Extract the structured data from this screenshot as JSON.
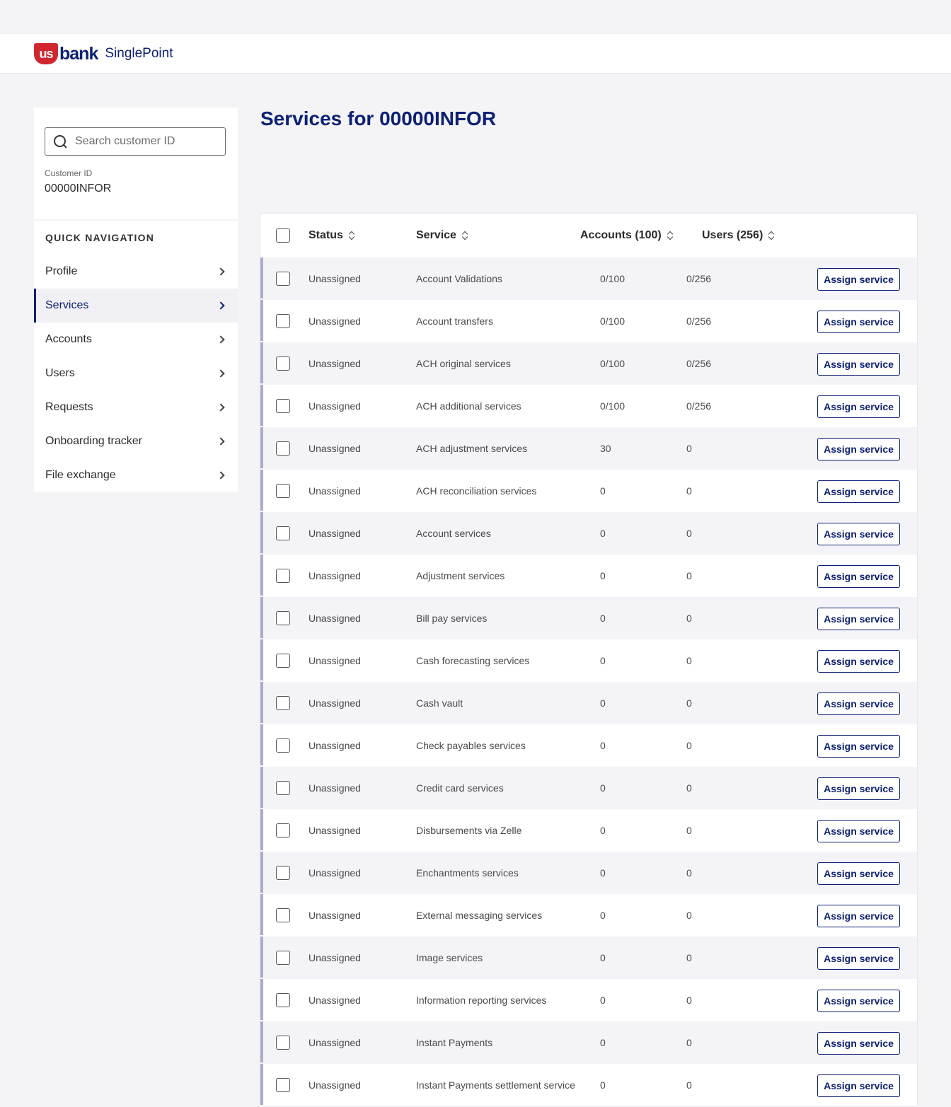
{
  "brand": {
    "shield_text": "us",
    "bank_text": "bank",
    "product_name": "SinglePoint",
    "colors": {
      "primary": "#0c2074",
      "accent": "#d12630"
    }
  },
  "sidebar": {
    "search": {
      "placeholder": "Search customer ID",
      "value": ""
    },
    "customer_label": "Customer ID",
    "customer_value": "00000INFOR",
    "nav_heading": "QUICK NAVIGATION",
    "items": [
      {
        "label": "Profile",
        "active": false
      },
      {
        "label": "Services",
        "active": true
      },
      {
        "label": "Accounts",
        "active": false
      },
      {
        "label": "Users",
        "active": false
      },
      {
        "label": "Requests",
        "active": false
      },
      {
        "label": "Onboarding tracker",
        "active": false
      },
      {
        "label": "File exchange",
        "active": false
      }
    ]
  },
  "main": {
    "title": "Services for 00000INFOR",
    "table": {
      "headers": {
        "status": "Status",
        "service": "Service",
        "accounts": "Accounts (100)",
        "users": "Users (256)"
      },
      "action_label": "Assign service",
      "rows": [
        {
          "status": "Unassigned",
          "service": "Account Validations",
          "accounts": "0/100",
          "users": "0/256"
        },
        {
          "status": "Unassigned",
          "service": "Account transfers",
          "accounts": "0/100",
          "users": "0/256"
        },
        {
          "status": "Unassigned",
          "service": "ACH original services",
          "accounts": "0/100",
          "users": "0/256"
        },
        {
          "status": "Unassigned",
          "service": "ACH additional services",
          "accounts": "0/100",
          "users": "0/256"
        },
        {
          "status": "Unassigned",
          "service": "ACH adjustment services",
          "accounts": "30",
          "users": "0"
        },
        {
          "status": "Unassigned",
          "service": "ACH reconciliation services",
          "accounts": "0",
          "users": "0"
        },
        {
          "status": "Unassigned",
          "service": "Account services",
          "accounts": "0",
          "users": "0"
        },
        {
          "status": "Unassigned",
          "service": "Adjustment services",
          "accounts": "0",
          "users": "0"
        },
        {
          "status": "Unassigned",
          "service": "Bill pay services",
          "accounts": "0",
          "users": "0"
        },
        {
          "status": "Unassigned",
          "service": "Cash forecasting services",
          "accounts": "0",
          "users": "0"
        },
        {
          "status": "Unassigned",
          "service": "Cash vault",
          "accounts": "0",
          "users": "0"
        },
        {
          "status": "Unassigned",
          "service": "Check payables services",
          "accounts": "0",
          "users": "0"
        },
        {
          "status": "Unassigned",
          "service": "Credit card services",
          "accounts": "0",
          "users": "0"
        },
        {
          "status": "Unassigned",
          "service": "Disbursements via Zelle",
          "accounts": "0",
          "users": "0"
        },
        {
          "status": "Unassigned",
          "service": "Enchantments services",
          "accounts": "0",
          "users": "0"
        },
        {
          "status": "Unassigned",
          "service": "External messaging services",
          "accounts": "0",
          "users": "0"
        },
        {
          "status": "Unassigned",
          "service": "Image services",
          "accounts": "0",
          "users": "0"
        },
        {
          "status": "Unassigned",
          "service": "Information reporting services",
          "accounts": "0",
          "users": "0"
        },
        {
          "status": "Unassigned",
          "service": "Instant Payments",
          "accounts": "0",
          "users": "0"
        },
        {
          "status": "Unassigned",
          "service": "Instant Payments settlement service",
          "accounts": "0",
          "users": "0"
        }
      ]
    }
  }
}
